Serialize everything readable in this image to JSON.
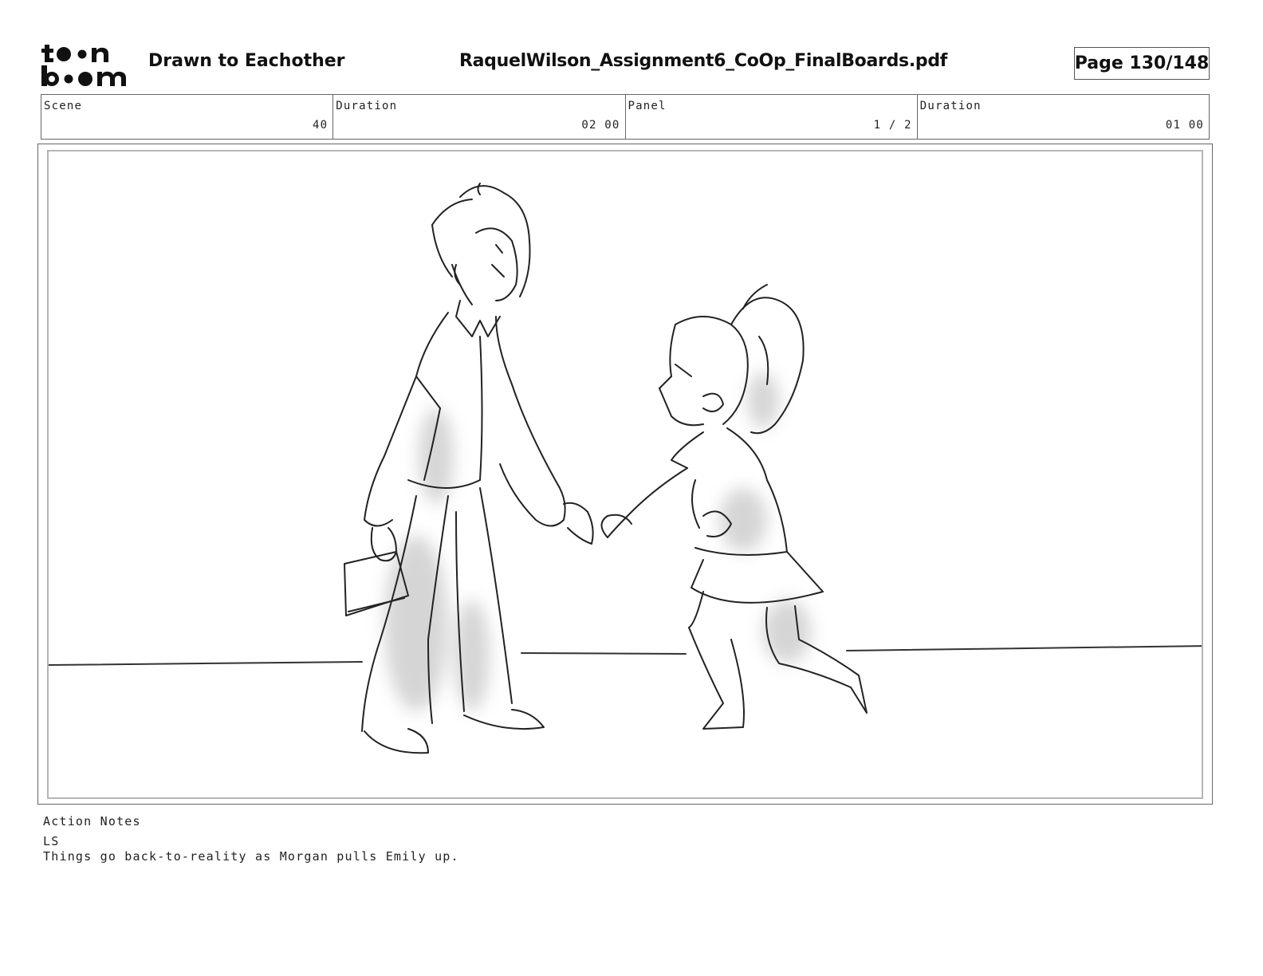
{
  "header": {
    "logo_text": "toonboom",
    "project_title": "Drawn to Eachother",
    "file_name": "RaquelWilson_Assignment6_CoOp_FinalBoards.pdf",
    "page_label": "Page 130/148"
  },
  "info": [
    {
      "label": "Scene",
      "value": "40"
    },
    {
      "label": "Duration",
      "value": "02 00"
    },
    {
      "label": "Panel",
      "value": "1 / 2"
    },
    {
      "label": "Duration",
      "value": "01 00"
    }
  ],
  "panel": {
    "description": ""
  },
  "notes": {
    "label": "Action Notes",
    "lines": [
      "LS",
      "Things go back-to-reality as Morgan pulls Emily up."
    ]
  }
}
